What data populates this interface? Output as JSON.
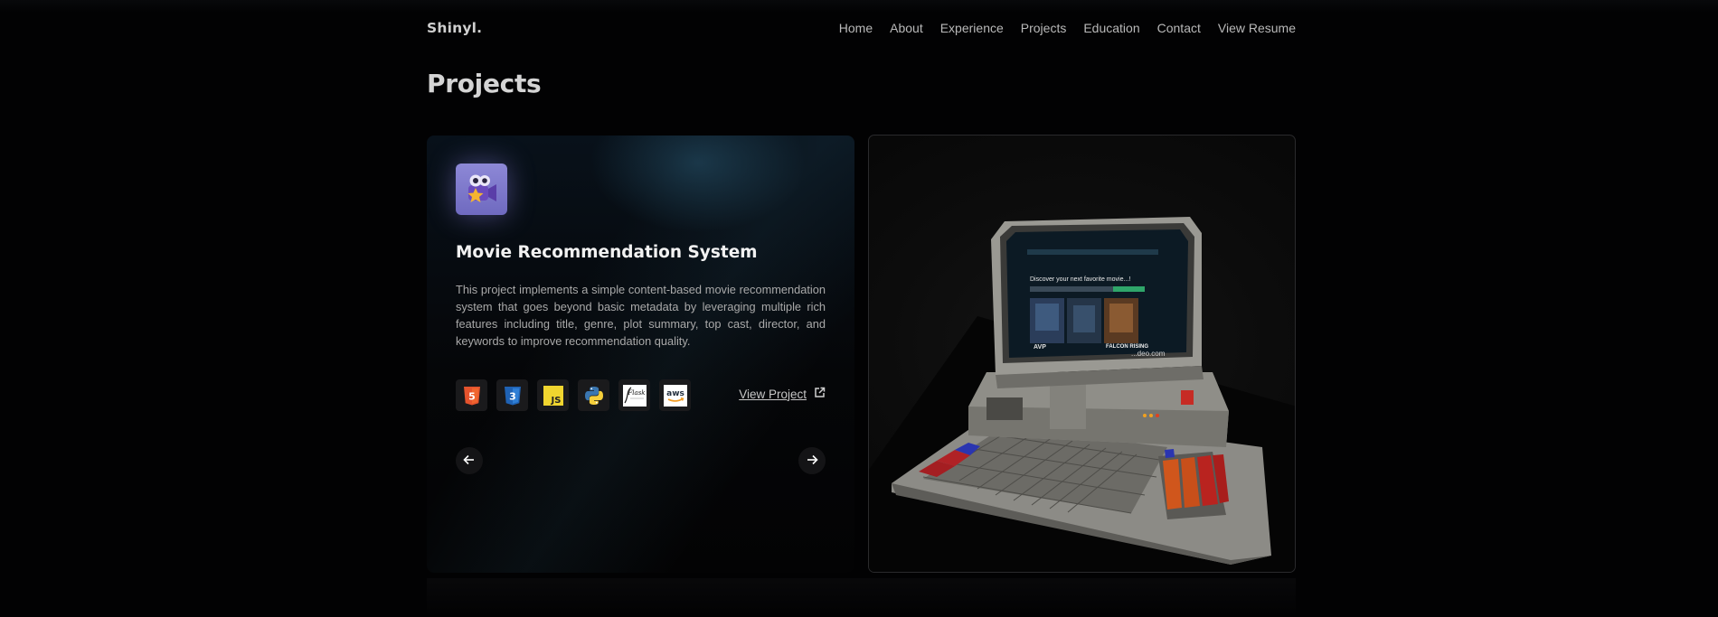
{
  "brand": "Shinyl.",
  "nav": {
    "links": [
      "Home",
      "About",
      "Experience",
      "Projects",
      "Education",
      "Contact",
      "View Resume"
    ]
  },
  "page_title": "Projects",
  "project": {
    "icon": "movie-camera-star-icon",
    "title": "Movie Recommendation System",
    "description": "This project implements a simple content-based movie recommendation system that goes beyond basic metadata by leveraging multiple rich features including title, genre, plot summary, top cast, director, and keywords to improve recommendation quality.",
    "tech_stack": [
      {
        "icon": "html5-icon",
        "label": "5"
      },
      {
        "icon": "css3-icon",
        "label": "3"
      },
      {
        "icon": "javascript-icon",
        "label": "JS"
      },
      {
        "icon": "python-icon",
        "label": ""
      },
      {
        "icon": "flask-icon",
        "label": "Flask"
      },
      {
        "icon": "aws-icon",
        "label": "aws"
      }
    ],
    "view_project_label": "View Project"
  },
  "retro_screen": {
    "headline": "Discover your next favorite movie...!",
    "poster_texts": [
      "AVP",
      "FALCON RISING"
    ],
    "watermark": "...deo.com"
  },
  "colors": {
    "background": "#020203",
    "icon_tile": "#7c77c9",
    "accent_green": "#2fa66a"
  }
}
